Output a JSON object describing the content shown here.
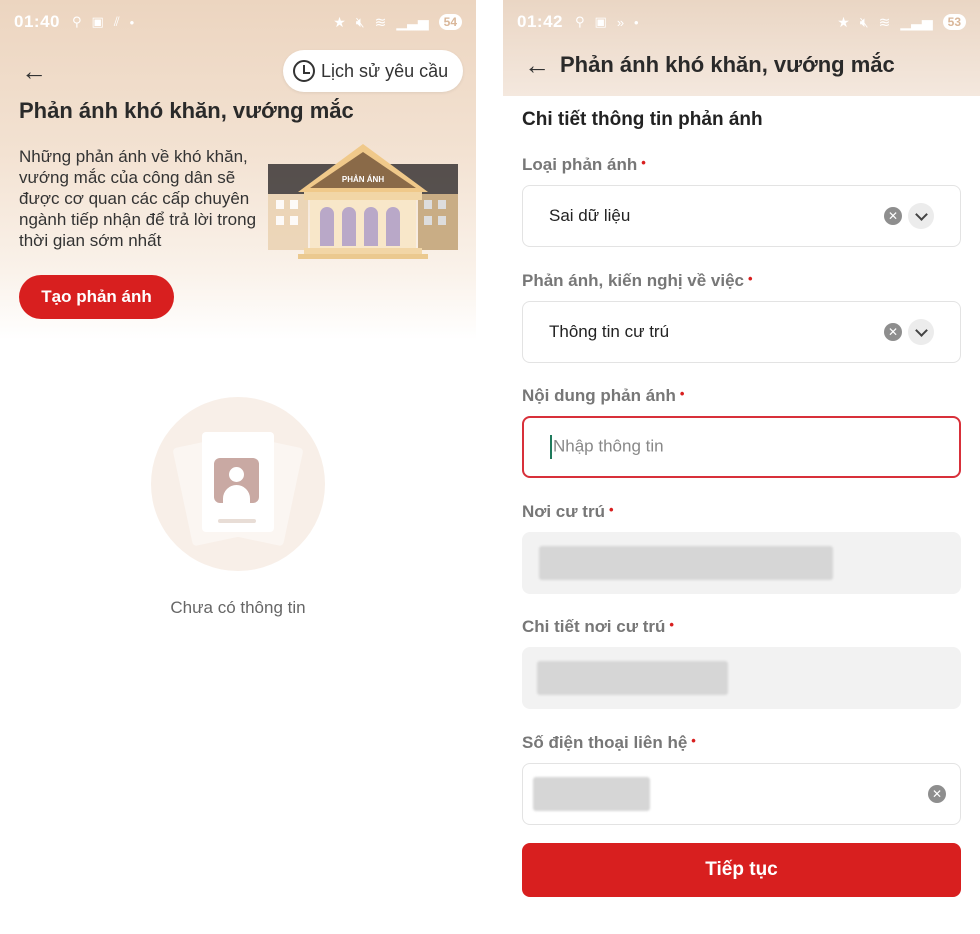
{
  "left": {
    "status_time": "01:40",
    "battery": "54",
    "history_label": "Lịch sử yêu cầu",
    "title": "Phản ánh khó khăn, vướng mắc",
    "description": "Những phản ánh về khó khăn, vướng mắc của công dân sẽ được cơ quan các cấp chuyên ngành tiếp nhận để trả lời trong thời gian sớm nhất",
    "building_sign": "PHẢN ÁNH",
    "create_label": "Tạo phản ánh",
    "empty_text": "Chưa có thông tin"
  },
  "right": {
    "status_time": "01:42",
    "battery": "53",
    "title": "Phản ánh khó khăn, vướng mắc",
    "section_title": "Chi tiết thông tin phản ánh",
    "fields": {
      "type": {
        "label": "Loại phản ánh",
        "value": "Sai dữ liệu"
      },
      "subject": {
        "label": "Phản ánh, kiến nghị về việc",
        "value": "Thông tin cư trú"
      },
      "content": {
        "label": "Nội dung phản ánh",
        "placeholder": "Nhập thông tin"
      },
      "residence": {
        "label": "Nơi cư trú"
      },
      "residence_detail": {
        "label": "Chi tiết nơi cư trú"
      },
      "phone": {
        "label": "Số điện thoại liên hệ"
      }
    },
    "required_mark": "•",
    "continue_label": "Tiếp tục"
  },
  "icons": {
    "back": "arrow-left",
    "history": "clock-history",
    "clear": "x-circle",
    "dropdown": "chevron-down"
  },
  "colors": {
    "primary": "#d81f1f",
    "header_bg": "#ecd5c0",
    "focus_border": "#d8303a"
  }
}
